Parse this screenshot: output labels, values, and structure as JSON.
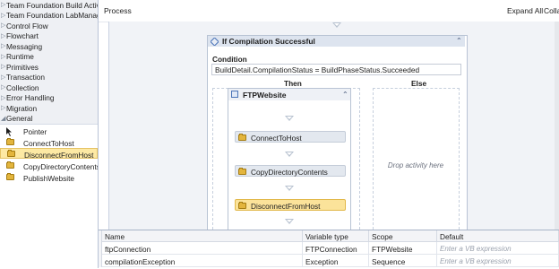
{
  "toolbox": {
    "categories": [
      {
        "label": "Team Foundation Build Activ..."
      },
      {
        "label": "Team Foundation LabManag..."
      },
      {
        "label": "Control Flow"
      },
      {
        "label": "Flowchart"
      },
      {
        "label": "Messaging"
      },
      {
        "label": "Runtime"
      },
      {
        "label": "Primitives"
      },
      {
        "label": "Transaction"
      },
      {
        "label": "Collection"
      },
      {
        "label": "Error Handling"
      },
      {
        "label": "Migration"
      }
    ],
    "open_category": {
      "label": "General"
    },
    "items": [
      {
        "label": "Pointer",
        "icon": "pointer-arrow-icon"
      },
      {
        "label": "ConnectToHost",
        "icon": "activity-icon"
      },
      {
        "label": "DisconnectFromHost",
        "icon": "activity-icon",
        "selected": true
      },
      {
        "label": "CopyDirectoryContents",
        "icon": "activity-icon"
      },
      {
        "label": "PublishWebsite",
        "icon": "activity-icon"
      }
    ]
  },
  "designer": {
    "breadcrumb": "Process",
    "expand_all": "Expand All",
    "collapse_all": "Colla",
    "if_activity": {
      "title": "If Compilation Successful",
      "condition_label": "Condition",
      "condition_value": "BuildDetail.CompilationStatus = BuildPhaseStatus.Succeeded",
      "then_label": "Then",
      "else_label": "Else",
      "else_placeholder": "Drop activity here"
    },
    "sequence": {
      "title": "FTPWebsite",
      "activities": [
        {
          "label": "ConnectToHost",
          "selected": false
        },
        {
          "label": "CopyDirectoryContents",
          "selected": false
        },
        {
          "label": "DisconnectFromHost",
          "selected": true
        }
      ]
    },
    "colors": {
      "selected_fill": "#fbe39a",
      "header_fill": "#dde4ef",
      "canvas": "#f1f3f7"
    }
  },
  "variables": {
    "columns": [
      "Name",
      "Variable type",
      "Scope",
      "Default"
    ],
    "rows": [
      {
        "name": "ftpConnection",
        "type": "FTPConnection",
        "scope": "FTPWebsite",
        "default": "Enter a VB expression"
      },
      {
        "name": "compilationException",
        "type": "Exception",
        "scope": "Sequence",
        "default": "Enter a VB expression"
      }
    ]
  }
}
